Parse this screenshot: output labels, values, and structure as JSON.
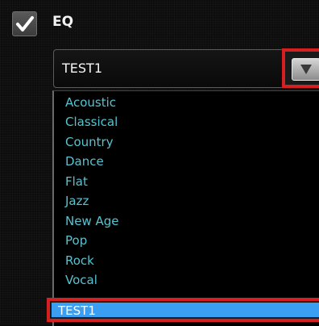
{
  "eq": {
    "enabled": true,
    "label": "EQ",
    "selected_value": "TEST1",
    "options": [
      "Acoustic",
      "Classical",
      "Country",
      "Dance",
      "Flat",
      "Jazz",
      "New Age",
      "Pop",
      "Rock",
      "Vocal"
    ],
    "highlighted_option": "TEST1"
  },
  "icons": {
    "checkbox": "checkmark-icon",
    "dropdown": "triangle-down-icon"
  },
  "colors": {
    "option_text": "#56c3d1",
    "highlight_bg": "#3a9ff0",
    "annotation_border": "#d32020"
  }
}
